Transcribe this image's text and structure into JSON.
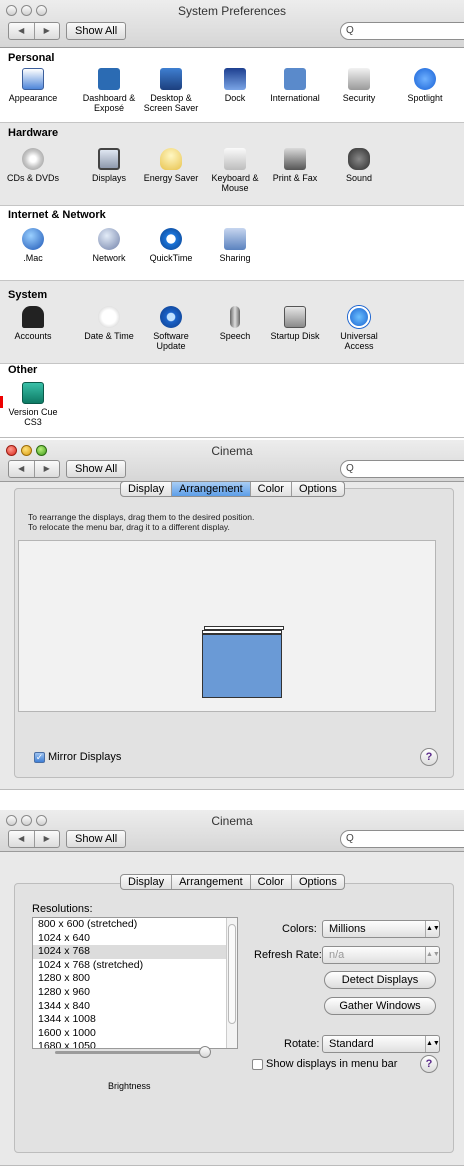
{
  "window1": {
    "title": "System Preferences",
    "show_all": "Show All",
    "search_placeholder": "Q",
    "sections": [
      {
        "title": "Personal",
        "items": [
          "Appearance",
          "Dashboard & Exposé",
          "Desktop & Screen Saver",
          "Dock",
          "International",
          "Security",
          "Spotlight"
        ]
      },
      {
        "title": "Hardware",
        "items": [
          "CDs & DVDs",
          "Displays",
          "Energy Saver",
          "Keyboard & Mouse",
          "Print & Fax",
          "Sound"
        ]
      },
      {
        "title": "Internet & Network",
        "items": [
          ".Mac",
          "Network",
          "QuickTime",
          "Sharing"
        ]
      },
      {
        "title": "System",
        "items": [
          "Accounts",
          "Date & Time",
          "Software Update",
          "Speech",
          "Startup Disk",
          "Universal Access"
        ]
      },
      {
        "title": "Other",
        "items": [
          "Version Cue CS3"
        ]
      }
    ]
  },
  "window2": {
    "title": "Cinema",
    "show_all": "Show All",
    "search_placeholder": "Q",
    "tabs": [
      "Display",
      "Arrangement",
      "Color",
      "Options"
    ],
    "selected_tab": "Arrangement",
    "instruction1": "To rearrange the displays, drag them to the desired position.",
    "instruction2": "To relocate the menu bar, drag it to a different display.",
    "mirror_label": "Mirror Displays",
    "mirror_checked": true,
    "help": "?"
  },
  "window3": {
    "title": "Cinema",
    "show_all": "Show All",
    "search_placeholder": "Q",
    "tabs": [
      "Display",
      "Arrangement",
      "Color",
      "Options"
    ],
    "resolutions_label": "Resolutions:",
    "resolutions": [
      "800 x 600 (stretched)",
      "1024 x 640",
      "1024 x 768",
      "1024 x 768 (stretched)",
      "1280 x 800",
      "1280 x 960",
      "1344 x 840",
      "1344 x 1008",
      "1600 x 1000",
      "1680 x 1050"
    ],
    "selected_resolution": "1024 x 768",
    "colors_label": "Colors:",
    "colors_value": "Millions",
    "refresh_label": "Refresh Rate:",
    "refresh_value": "n/a",
    "detect_btn": "Detect Displays",
    "gather_btn": "Gather Windows",
    "rotate_label": "Rotate:",
    "rotate_value": "Standard",
    "show_menu_label": "Show displays in menu bar",
    "brightness_label": "Brightness",
    "help": "?"
  }
}
